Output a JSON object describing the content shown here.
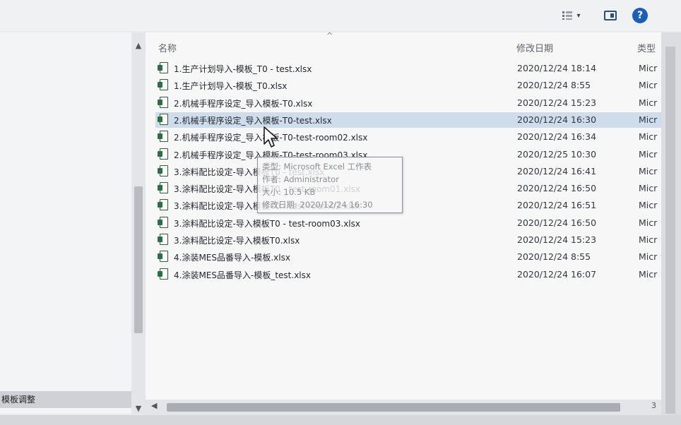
{
  "toolbar": {
    "view_icon": "details-view-icon",
    "caret": "▾",
    "help_label": "?"
  },
  "nav": {
    "selected_item": "模板调整"
  },
  "list": {
    "sort_arrow": "^",
    "columns": {
      "name": "名称",
      "date": "修改日期",
      "type": "类型"
    },
    "rows": [
      {
        "name": "1.生产计划导入-模板_T0 - test.xlsx",
        "date": "2020/12/24 18:14",
        "type": "Micr"
      },
      {
        "name": "1.生产计划导入-模板_T0.xlsx",
        "date": "2020/12/24 8:55",
        "type": "Micr"
      },
      {
        "name": "2.机械手程序设定_导入模板-T0.xlsx",
        "date": "2020/12/24 15:23",
        "type": "Micr"
      },
      {
        "name": "2.机械手程序设定_导入模板-T0-test.xlsx",
        "date": "2020/12/24 16:30",
        "type": "Micr"
      },
      {
        "name": "2.机械手程序设定_导入模板-T0-test-room02.xlsx",
        "date": "2020/12/24 16:34",
        "type": "Micr"
      },
      {
        "name": "2.机械手程序设定_导入模板-T0-test-room03.xlsx",
        "date": "2020/12/25 10:30",
        "type": "Micr"
      },
      {
        "name": "3.涂料配比设定-导入模板T0 - test.xlsx",
        "date": "2020/12/24 16:41",
        "type": "Micr"
      },
      {
        "name": "3.涂料配比设定-导入模板T0 - test-room01.xlsx",
        "date": "2020/12/24 16:50",
        "type": "Micr"
      },
      {
        "name": "3.涂料配比设定-导入模板T0 - test-room02.xlsx",
        "date": "2020/12/24 16:51",
        "type": "Micr"
      },
      {
        "name": "3.涂料配比设定-导入模板T0 - test-room03.xlsx",
        "date": "2020/12/24 16:50",
        "type": "Micr"
      },
      {
        "name": "3.涂料配比设定-导入模板T0.xlsx",
        "date": "2020/12/24 15:23",
        "type": "Micr"
      },
      {
        "name": "4.涂装MES品番导入-模板.xlsx",
        "date": "2020/12/24 8:55",
        "type": "Micr"
      },
      {
        "name": "4.涂装MES品番导入-模板_test.xlsx",
        "date": "2020/12/24 16:07",
        "type": "Micr"
      }
    ],
    "selected_index": 3
  },
  "tooltip": {
    "line1": "类型: Microsoft Excel 工作表",
    "line2": "作者: Administrator",
    "line3": "大小: 10.5 KB",
    "line4": "修改日期: 2020/12/24 16:30"
  },
  "scroll": {
    "up": "▲",
    "down": "▼",
    "left": "◀",
    "right": "3"
  }
}
